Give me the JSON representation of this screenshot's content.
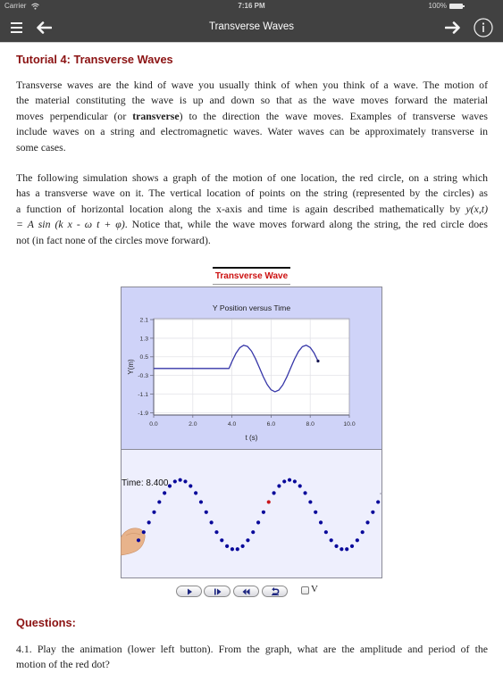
{
  "status_bar": {
    "carrier": "Carrier",
    "time": "7:16 PM",
    "battery": "100%",
    "icons": [
      "wifi-icon",
      "battery-icon"
    ]
  },
  "nav": {
    "title": "Transverse Waves",
    "left_icons": [
      "menu-icon",
      "back-arrow-icon"
    ],
    "right_icons": [
      "forward-arrow-icon",
      "info-icon"
    ]
  },
  "theme": {
    "nav_bg": "#414141",
    "heading_color": "#8b1212",
    "sim_title_color": "#cc1111",
    "graph_panel_bg": "#cfd3f8",
    "string_panel_bg": "#eeeffd",
    "curve_color": "#3636a8",
    "dot_color": "#08089a",
    "red_dot_color": "#c8161c",
    "hand_color": "#e8b38b"
  },
  "article": {
    "heading": "Tutorial 4: Transverse Waves",
    "intro_lines": [
      [
        {
          "text": "Transverse waves are the kind of wave you usually think of when you think of a wave. The motion of",
          "style": "normal"
        }
      ],
      [
        {
          "text": "the material constituting the wave is up and down so that as the wave moves forward the material",
          "style": "normal"
        }
      ],
      [
        {
          "text": "moves perpendicular (or ",
          "style": "normal"
        },
        {
          "text": "transverse",
          "style": "bold"
        },
        {
          "text": ") to the direction the wave moves. Examples of transverse waves",
          "style": "normal"
        }
      ],
      [
        {
          "text": "include waves on a string and electromagnetic waves. Water waves can be approximately transverse in",
          "style": "normal"
        }
      ],
      [
        {
          "text": "some cases.",
          "style": "normal"
        }
      ]
    ],
    "simulation_lines": [
      [
        {
          "text": "The following simulation shows a graph of the motion of one location, the red circle, on a string which",
          "style": "normal"
        }
      ],
      [
        {
          "text": "has a transverse wave on it. The vertical location of points on the string (represented by the circles) as",
          "style": "normal"
        }
      ],
      [
        {
          "text": "a function of horizontal location along the x-axis and time is again described mathematically by ",
          "style": "normal"
        },
        {
          "text": "y(x,t)",
          "style": "italic"
        }
      ],
      [
        {
          "text": "= A sin (k x - ω t + φ)",
          "style": "italic"
        },
        {
          "text": ". Notice that, while the wave moves forward along the string, the red circle does",
          "style": "normal"
        }
      ],
      [
        {
          "text": "not (in fact none of the circles move forward).",
          "style": "normal"
        }
      ]
    ],
    "questions_heading": "Questions:",
    "question_lines": [
      [
        {
          "text": "4.1. Play the animation (lower left button). From the graph, what are the amplitude and period of the",
          "style": "normal"
        }
      ],
      [
        {
          "text": "motion of the red dot?",
          "style": "normal"
        }
      ]
    ]
  },
  "simulation": {
    "title": "Transverse Wave",
    "time_label": "Time: 8.400",
    "controls": [
      {
        "name": "play-button",
        "icon": "play-icon"
      },
      {
        "name": "step-forward-button",
        "icon": "step-forward-icon"
      },
      {
        "name": "rewind-button",
        "icon": "rewind-icon"
      },
      {
        "name": "reset-button",
        "icon": "reset-icon"
      }
    ],
    "checkbox": {
      "label": "V",
      "checked": false
    },
    "string": {
      "num_points": 47,
      "red_index": 25,
      "points_per_wavelength": 21,
      "amplitude_m": 1.0,
      "phase_offset_points": 2.75
    }
  },
  "chart_data": {
    "type": "line",
    "title": "Y Position versus Time",
    "xlabel": "t (s)",
    "ylabel": "Y(m)",
    "xlim": [
      0,
      10
    ],
    "ylim": [
      -2.0,
      2.14
    ],
    "xticks": [
      0.0,
      2.0,
      4.0,
      6.0,
      8.0,
      10.0
    ],
    "xtick_labels": [
      "0.0",
      "2.0",
      "4.0",
      "6.0",
      "8.0",
      "10.0"
    ],
    "yticks": [
      2.1,
      1.3,
      0.5,
      -0.3,
      -1.1,
      -1.9
    ],
    "ytick_labels": [
      "2.1",
      "1.3",
      "0.5",
      "-0.3",
      "-1.1",
      "-1.9"
    ],
    "grid": true,
    "legend": "none",
    "series": [
      {
        "name": "Y position of red circle",
        "x": [
          0.0,
          3.85,
          4.0,
          4.2,
          4.4,
          4.6,
          4.8,
          5.0,
          5.2,
          5.4,
          5.6,
          5.8,
          6.0,
          6.2,
          6.4,
          6.6,
          6.8,
          7.0,
          7.2,
          7.4,
          7.6,
          7.8,
          8.0,
          8.2,
          8.4
        ],
        "y": [
          0,
          0,
          0.296,
          0.644,
          0.891,
          0.997,
          0.946,
          0.746,
          0.427,
          0.042,
          -0.351,
          -0.688,
          -0.916,
          -1.0,
          -0.926,
          -0.706,
          -0.374,
          0.017,
          0.405,
          0.729,
          0.938,
          0.999,
          0.902,
          0.663,
          0.319
        ]
      }
    ]
  }
}
